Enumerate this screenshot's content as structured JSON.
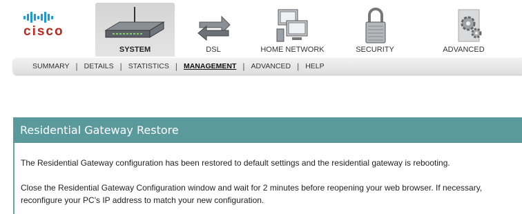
{
  "brand": {
    "name": "cisco",
    "colors": {
      "bars": "#1a9bd7",
      "word": "#c0281e"
    }
  },
  "nav": {
    "items": [
      {
        "label": "SYSTEM",
        "icon": "router-icon",
        "active": true
      },
      {
        "label": "DSL",
        "icon": "arrows-exchange-icon",
        "active": false
      },
      {
        "label": "HOME NETWORK",
        "icon": "computers-icon",
        "active": false
      },
      {
        "label": "SECURITY",
        "icon": "padlock-icon",
        "active": false
      },
      {
        "label": "ADVANCED",
        "icon": "gears-icon",
        "active": false
      }
    ]
  },
  "subnav": {
    "items": [
      {
        "label": "SUMMARY",
        "active": false
      },
      {
        "label": "DETAILS",
        "active": false
      },
      {
        "label": "STATISTICS",
        "active": false
      },
      {
        "label": "MANAGEMENT",
        "active": true
      },
      {
        "label": "ADVANCED",
        "active": false
      },
      {
        "label": "HELP",
        "active": false
      }
    ]
  },
  "panel": {
    "title": "Residential Gateway Restore",
    "paragraph1": "The Residential Gateway configuration has been restored to default settings and the residential gateway is rebooting.",
    "paragraph2": "Close the Residential Gateway Configuration window and wait for 2 minutes before reopening your web browser. If necessary, reconfigure your PC's IP address to match your new configuration.",
    "color": "#5b9a9c"
  }
}
